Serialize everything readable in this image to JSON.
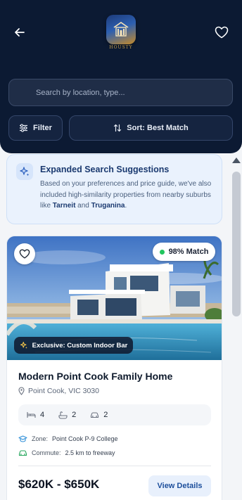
{
  "header": {
    "logo_text": "HOUSTY"
  },
  "search": {
    "placeholder": "Search by location, type..."
  },
  "toolbar": {
    "filter_label": "Filter",
    "sort_label": "Sort: Best Match"
  },
  "suggestion": {
    "title": "Expanded Search Suggestions",
    "body_prefix": "Based on your preferences and price guide, we've also included high-similarity properties from nearby suburbs like ",
    "suburb_1": "Tarneit",
    "joiner": " and ",
    "suburb_2": "Truganina",
    "body_suffix": "."
  },
  "listing": {
    "match": "98% Match",
    "exclusive": "Exclusive: Custom Indoor Bar",
    "title": "Modern Point Cook Family Home",
    "location": "Point Cook, VIC 3030",
    "beds": "4",
    "baths": "2",
    "cars": "2",
    "zone_label": "Zone:",
    "zone_value": "Point Cook P-9 College",
    "commute_label": "Commute:",
    "commute_value": "2.5 km to freeway",
    "price": "$620K - $650K",
    "details_label": "View Details"
  },
  "colors": {
    "header_bg": "#0c1a33",
    "accent": "#1d4f9c",
    "match_dot": "#22c55e"
  },
  "icons": [
    "arrow-left-icon",
    "heart-icon",
    "search-icon",
    "sliders-icon",
    "sort-arrows-icon",
    "sparkle-icon",
    "map-pin-icon",
    "bed-icon",
    "bath-icon",
    "car-icon",
    "graduation-cap-icon"
  ]
}
